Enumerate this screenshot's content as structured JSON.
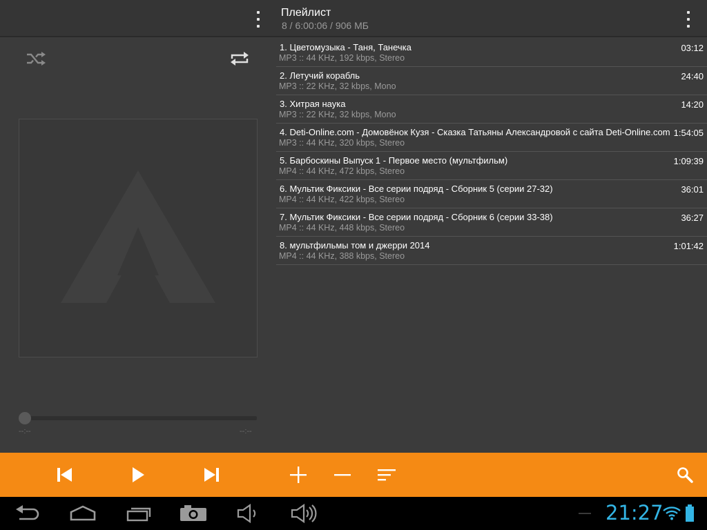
{
  "playlist_header": {
    "title": "Плейлист",
    "stats": "8 / 6:00:06 / 906 МБ"
  },
  "player": {
    "time_elapsed": "--:--",
    "time_total": "--:--",
    "seek_fraction": 0,
    "shuffle_icon": "shuffle-icon",
    "repeat_icon": "repeat-icon"
  },
  "tracks": [
    {
      "title": "1. Цветомузыка - Таня, Танечка",
      "meta": "MP3 :: 44 KHz, 192 kbps, Stereo",
      "duration": "03:12"
    },
    {
      "title": "2. Летучий корабль",
      "meta": "MP3 :: 22 KHz, 32 kbps, Mono",
      "duration": "24:40"
    },
    {
      "title": "3. Хитрая наука",
      "meta": "MP3 :: 22 KHz, 32 kbps, Mono",
      "duration": "14:20"
    },
    {
      "title": "4. Deti-Online.com - Домовёнок Кузя - Сказка Татьяны Александровой с сайта Deti-Online.com",
      "meta": "MP3 :: 44 KHz, 320 kbps, Stereo",
      "duration": "1:54:05"
    },
    {
      "title": "5. Барбоскины Выпуск 1 - Первое место (мультфильм)",
      "meta": "MP4 :: 44 KHz, 472 kbps, Stereo",
      "duration": "1:09:39"
    },
    {
      "title": "6. Мультик Фиксики - Все серии подряд - Сборник 5 (серии 27-32)",
      "meta": "MP4 :: 44 KHz, 422 kbps, Stereo",
      "duration": "36:01"
    },
    {
      "title": "7. Мультик Фиксики - Все серии подряд - Сборник 6 (серии 33-38)",
      "meta": "MP4 :: 44 KHz, 448 kbps, Stereo",
      "duration": "36:27"
    },
    {
      "title": "8. мультфильмы том и джерри 2014",
      "meta": "MP4 :: 44 KHz, 388 kbps, Stereo",
      "duration": "1:01:42"
    }
  ],
  "controls": [
    "previous-icon",
    "play-icon",
    "next-icon",
    "add-icon",
    "remove-icon",
    "sort-icon",
    "search-icon"
  ],
  "status_bar": {
    "clock": "21:27",
    "icons": [
      "wifi-icon",
      "battery-icon"
    ]
  },
  "nav_bar": [
    "back-icon",
    "home-icon",
    "recent-apps-icon",
    "screenshot-icon",
    "volume-down-icon",
    "volume-up-icon"
  ],
  "colors": {
    "accent": "#f58a14",
    "clock": "#33b5e5",
    "background": "#3b3b3b"
  }
}
